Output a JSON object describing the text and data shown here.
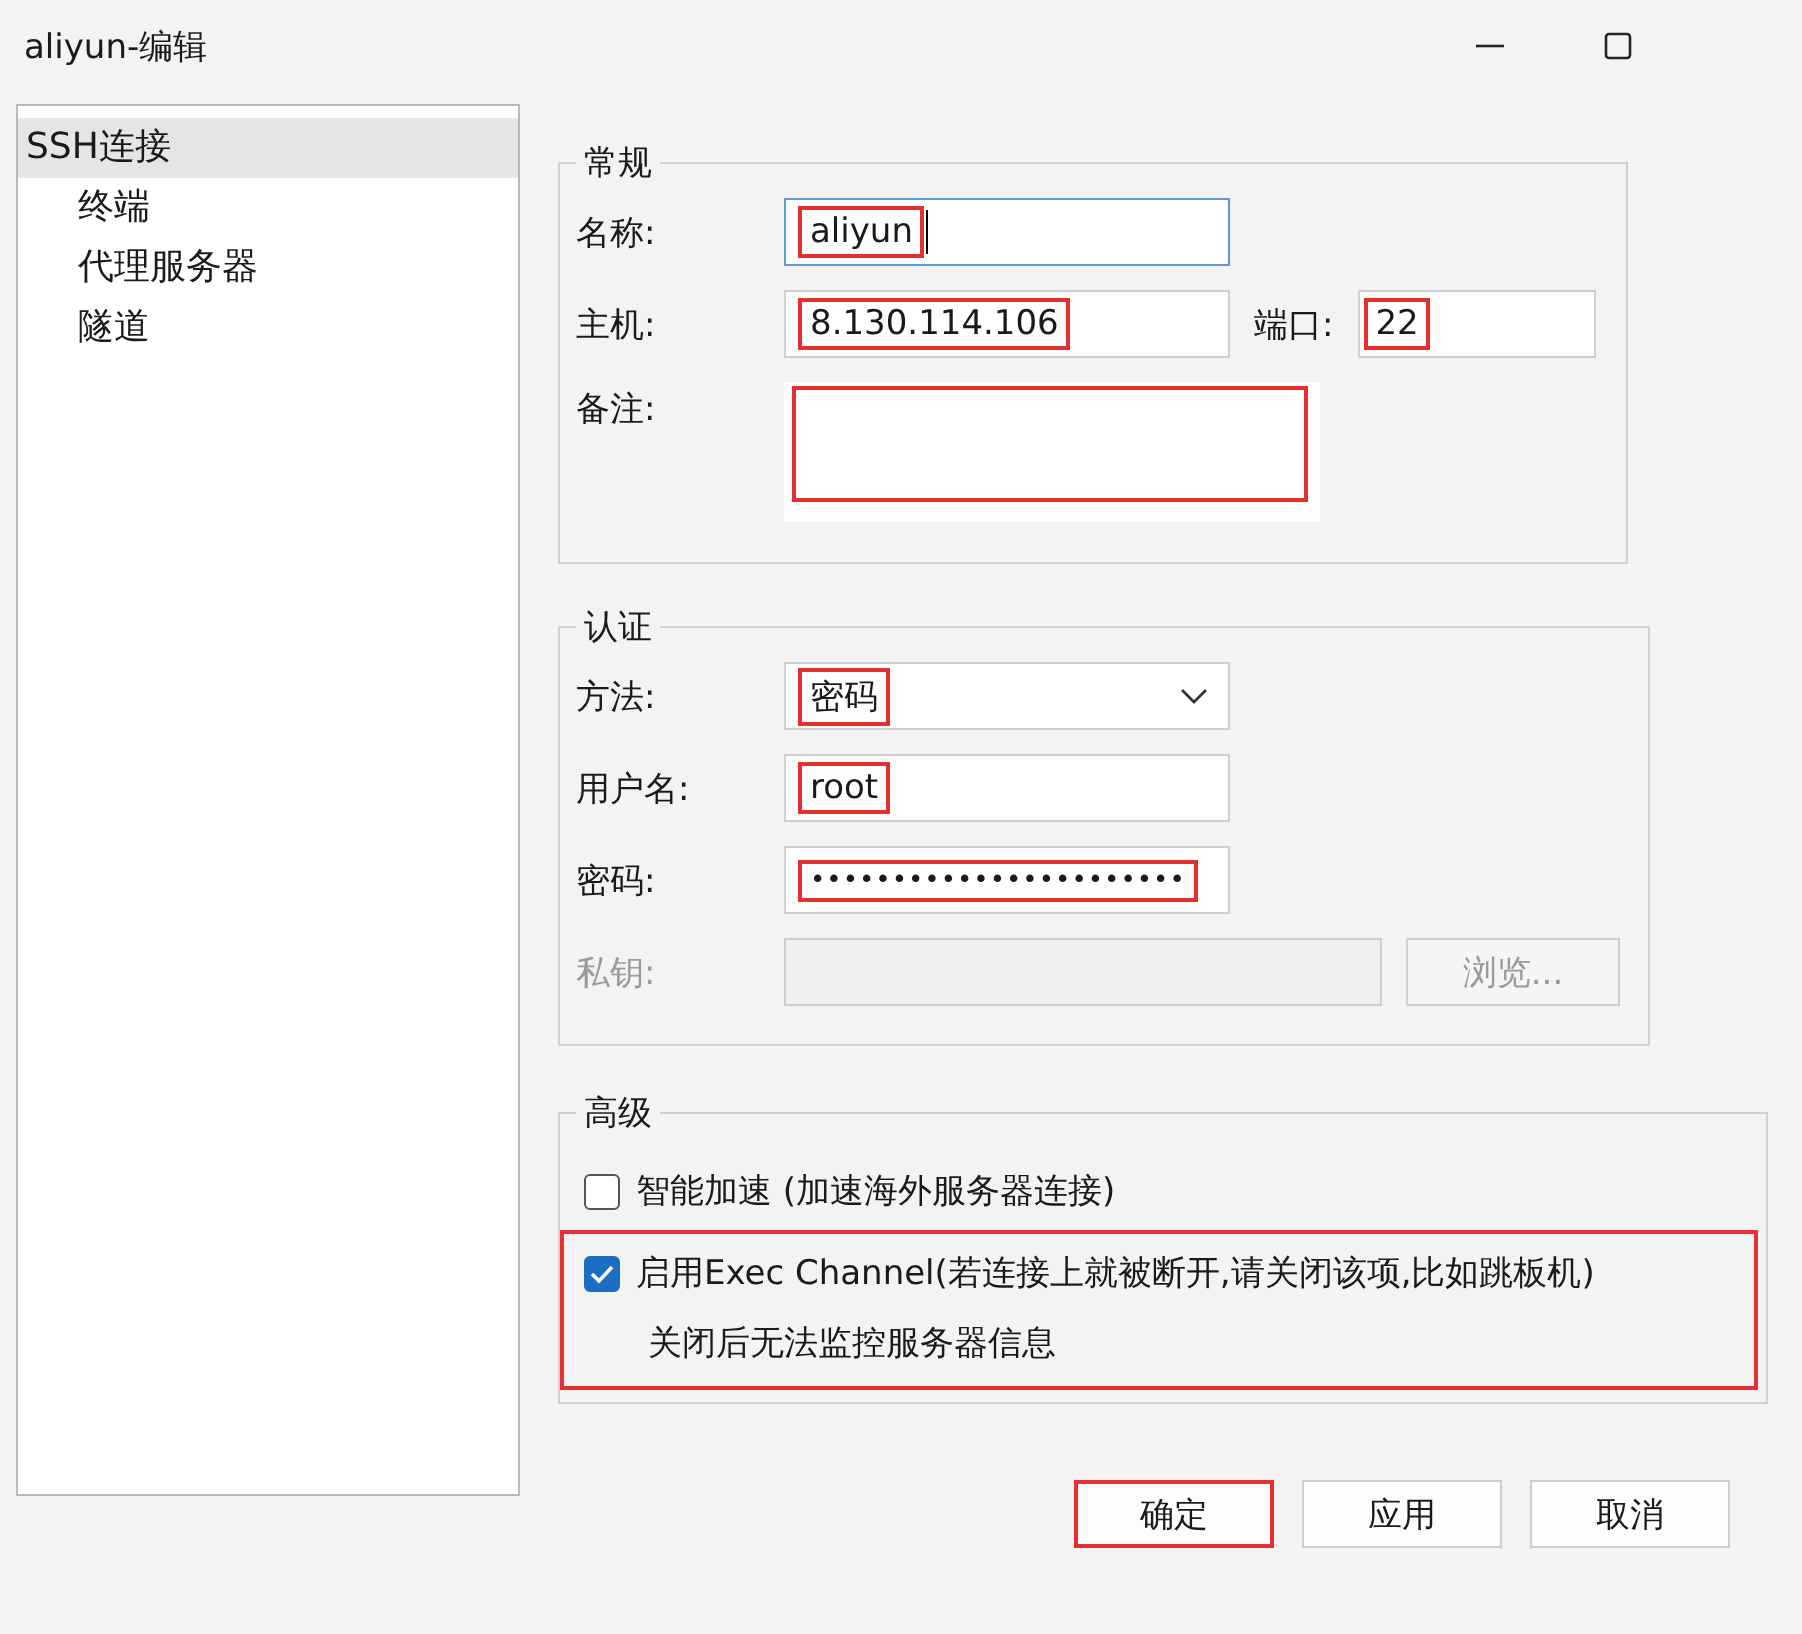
{
  "window": {
    "title": "aliyun-编辑"
  },
  "tree": [
    {
      "label": "SSH连接",
      "selected": true,
      "children": [
        {
          "label": "终端",
          "selected": false
        },
        {
          "label": "代理服务器",
          "selected": false
        },
        {
          "label": "隧道",
          "selected": false
        }
      ]
    }
  ],
  "groups": [
    {
      "title": "常规",
      "rows": [
        {
          "kind": "text",
          "label": "名称:",
          "value": "aliyun",
          "focused": true,
          "highlighted": true
        },
        {
          "kind": "text",
          "label": "主机:",
          "value": "8.130.114.106",
          "focused": false,
          "highlighted": true,
          "port": {
            "label": "端口:",
            "value": "22",
            "highlighted": true
          }
        },
        {
          "kind": "textarea",
          "label": "备注:",
          "highlighted": true
        }
      ]
    },
    {
      "title": "认证",
      "rows": [
        {
          "kind": "select",
          "label": "方法:",
          "value": "密码",
          "highlighted": true
        },
        {
          "kind": "text",
          "label": "用户名:",
          "value": "root",
          "focused": false,
          "highlighted": true
        },
        {
          "kind": "password",
          "label": "密码:",
          "value": "•••••••••••••••••••••••",
          "highlighted": true
        },
        {
          "kind": "file",
          "label": "私钥:",
          "button": "浏览...",
          "disabled": true
        }
      ]
    },
    {
      "title": "高级",
      "checks": [
        {
          "label": "智能加速 (加速海外服务器连接)",
          "checked": false,
          "highlighted": false
        },
        {
          "label": "启用Exec Channel(若连接上就被断开,请关闭该项,比如跳板机)",
          "checked": true,
          "highlighted": true,
          "note": "关闭后无法监控服务器信息"
        }
      ]
    }
  ],
  "buttons": [
    {
      "label": "确定",
      "highlighted": true
    },
    {
      "label": "应用",
      "highlighted": false
    },
    {
      "label": "取消",
      "highlighted": false
    }
  ]
}
